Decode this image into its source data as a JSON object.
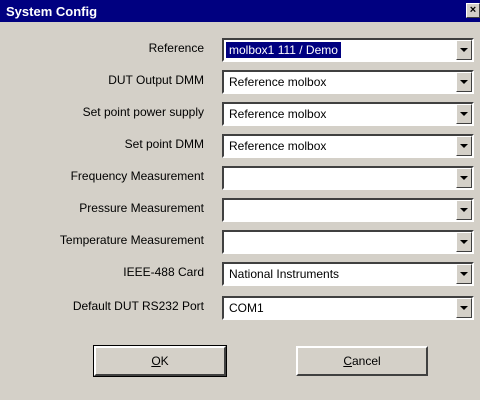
{
  "window": {
    "title": "System Config",
    "close_glyph": "×"
  },
  "fields": [
    {
      "label": "Reference",
      "value": "molbox1 111 / Demo",
      "selected": true
    },
    {
      "label": "DUT Output DMM",
      "value": "Reference molbox"
    },
    {
      "label": "Set point power supply",
      "value": "Reference molbox"
    },
    {
      "label": "Set point DMM",
      "value": "Reference molbox"
    },
    {
      "label": "Frequency Measurement",
      "value": ""
    },
    {
      "label": "Pressure Measurement",
      "value": ""
    },
    {
      "label": "Temperature Measurement",
      "value": ""
    },
    {
      "label": "IEEE-488 Card",
      "value": "National Instruments"
    },
    {
      "label": "Default DUT RS232 Port",
      "value": "COM1"
    }
  ],
  "buttons": {
    "ok": {
      "accel": "O",
      "rest": "K"
    },
    "cancel": {
      "accel": "C",
      "rest": "ancel"
    }
  },
  "colors": {
    "titlebar": "#000080",
    "face": "#d4d0c8",
    "selection": "#000080"
  }
}
